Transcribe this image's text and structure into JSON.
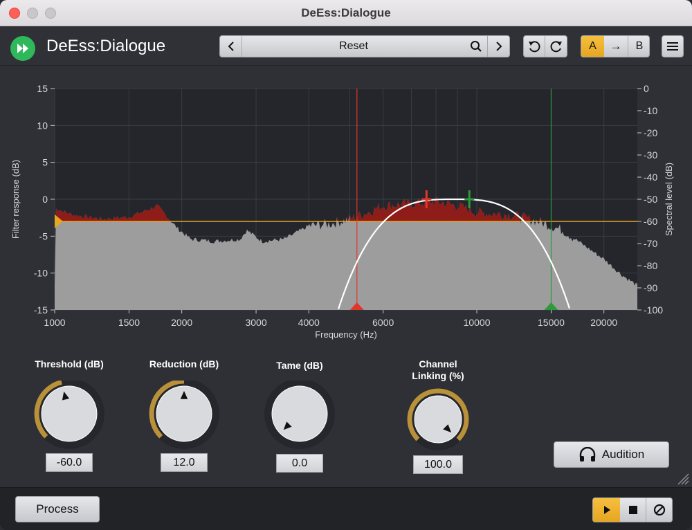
{
  "window": {
    "title": "DeEss:Dialogue"
  },
  "header": {
    "app_title": "DeEss:Dialogue",
    "preset_name": "Reset",
    "ab": {
      "a": "A",
      "copy": "→",
      "b": "B"
    }
  },
  "graph": {
    "left_axis_label": "Filter response (dB)",
    "right_axis_label": "Spectral level (dB)",
    "x_axis_label": "Frequency (Hz)",
    "left_ticks": [
      "15",
      "10",
      "5",
      "0",
      "-5",
      "-10",
      "-15"
    ],
    "left_range": [
      -15,
      15
    ],
    "right_ticks": [
      "0",
      "-10",
      "-20",
      "-30",
      "-40",
      "-50",
      "-60",
      "-70",
      "-80",
      "-90",
      "-100"
    ],
    "right_range": [
      -100,
      0
    ],
    "x_ticks": [
      "1000",
      "1500",
      "2000",
      "3000",
      "4000",
      "6000",
      "10000",
      "15000",
      "20000"
    ],
    "x_tick_values": [
      1000,
      1500,
      2000,
      3000,
      4000,
      6000,
      10000,
      15000,
      20000
    ],
    "x_range": [
      1000,
      24000
    ],
    "x_gridlines": [
      1000,
      1500,
      2000,
      3000,
      4000,
      5000,
      6000,
      7000,
      8000,
      9000,
      10000,
      15000,
      20000
    ],
    "threshold_level": -60,
    "low_marker_hz": 5200,
    "high_marker_hz": 15000,
    "filter_peak_handles_hz": [
      7600,
      9600
    ],
    "colors": {
      "background": "#24262c",
      "spectrum": "#9d9d9d",
      "detected": "#8e1c19",
      "filter_curve": "#ffffff",
      "threshold": "#e6a621",
      "low_marker": "#e2362b",
      "high_marker": "#2e9a3a"
    }
  },
  "controls": {
    "threshold": {
      "label": "Threshold (dB)",
      "value": "-60.0",
      "fraction": 0.45
    },
    "reduction": {
      "label": "Reduction (dB)",
      "value": "12.0",
      "fraction": 0.5
    },
    "tame": {
      "label": "Tame (dB)",
      "value": "0.0",
      "fraction": 0.0
    },
    "linking": {
      "label_line1": "Channel",
      "label_line2": "Linking (%)",
      "value": "100.0",
      "fraction": 1.0
    },
    "accent_color": "#b8913a"
  },
  "audition": {
    "label": "Audition",
    "icon": "headphones-icon"
  },
  "footer": {
    "process_label": "Process"
  }
}
